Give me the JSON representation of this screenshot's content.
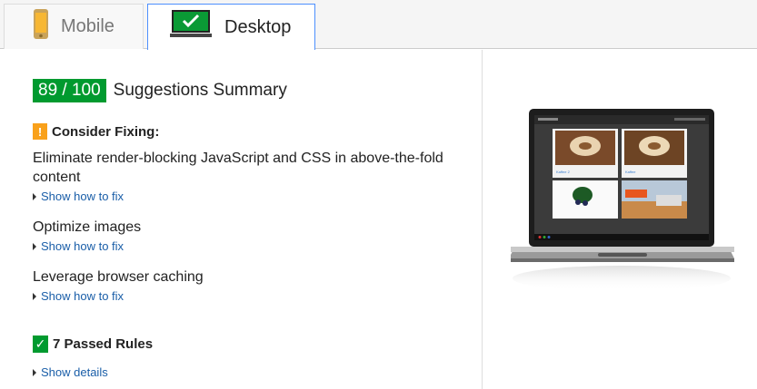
{
  "tabs": {
    "mobile": {
      "label": "Mobile",
      "icon": "phone-icon"
    },
    "desktop": {
      "label": "Desktop",
      "icon": "monitor-check-icon",
      "selected": true
    }
  },
  "summary": {
    "score": "89 / 100",
    "title": "Suggestions Summary",
    "score_color": "#009a2f"
  },
  "consider": {
    "icon": "warning-icon",
    "icon_glyph": "!",
    "label": "Consider Fixing:",
    "color": "#f9a11b",
    "rules": [
      {
        "title": "Eliminate render-blocking JavaScript and CSS in above-the-fold content",
        "link": "Show how to fix"
      },
      {
        "title": "Optimize images",
        "link": "Show how to fix"
      },
      {
        "title": "Leverage browser caching",
        "link": "Show how to fix"
      }
    ]
  },
  "passed": {
    "icon": "check-icon",
    "icon_glyph": "✓",
    "label": "7 Passed Rules",
    "link": "Show details"
  },
  "preview": {
    "device": "laptop",
    "captions": [
      "Kaffee 2",
      "Kaffee"
    ]
  }
}
